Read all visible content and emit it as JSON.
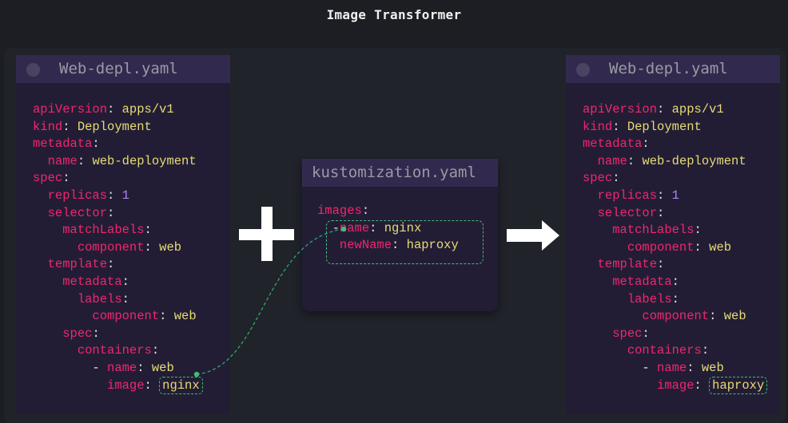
{
  "title": "Image Transformer",
  "left_panel": {
    "filename": "Web-depl.yaml",
    "yaml": {
      "apiVersion_key": "apiVersion",
      "apiVersion_val": "apps/v1",
      "kind_key": "kind",
      "kind_val": "Deployment",
      "metadata_key": "metadata",
      "name_key": "name",
      "name_val": "web-deployment",
      "spec_key": "spec",
      "replicas_key": "replicas",
      "replicas_val": "1",
      "selector_key": "selector",
      "matchLabels_key": "matchLabels",
      "component_key": "component",
      "component_val": "web",
      "template_key": "template",
      "tmeta_key": "metadata",
      "labels_key": "labels",
      "lcomponent_key": "component",
      "lcomponent_val": "web",
      "tspec_key": "spec",
      "containers_key": "containers",
      "cname_key": "name",
      "cname_val": "web",
      "image_key": "image",
      "image_val": "nginx"
    }
  },
  "kustomization": {
    "filename": "kustomization.yaml",
    "images_key": "images",
    "name_key": "name",
    "name_val": "nginx",
    "newName_key": "newName",
    "newName_val": "haproxy"
  },
  "right_panel": {
    "filename": "Web-depl.yaml",
    "yaml": {
      "apiVersion_key": "apiVersion",
      "apiVersion_val": "apps/v1",
      "kind_key": "kind",
      "kind_val": "Deployment",
      "metadata_key": "metadata",
      "name_key": "name",
      "name_val": "web-deployment",
      "spec_key": "spec",
      "replicas_key": "replicas",
      "replicas_val": "1",
      "selector_key": "selector",
      "matchLabels_key": "matchLabels",
      "component_key": "component",
      "component_val": "web",
      "template_key": "template",
      "tmeta_key": "metadata",
      "labels_key": "labels",
      "lcomponent_key": "component",
      "lcomponent_val": "web",
      "tspec_key": "spec",
      "containers_key": "containers",
      "cname_key": "name",
      "cname_val": "web",
      "image_key": "image",
      "image_val": "haproxy"
    }
  },
  "colors": {
    "key": "#f0266f",
    "value": "#e6db74",
    "number": "#ae81ff",
    "panel": "#221d35",
    "header": "#322a4e",
    "highlight": "#3fbf72"
  },
  "icons": {
    "operator": "plus-icon",
    "result": "arrow-right-icon"
  }
}
